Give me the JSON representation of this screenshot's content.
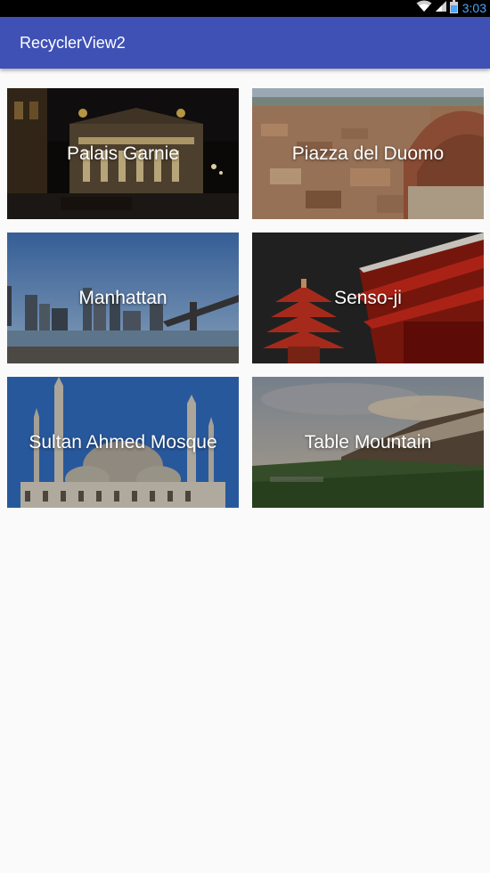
{
  "status_bar": {
    "time": "3:03",
    "icons": [
      "wifi-icon",
      "signal-icon",
      "battery-icon"
    ],
    "time_color": "#4aa6ff"
  },
  "app_bar": {
    "title": "RecyclerView2",
    "color": "#3f51b5"
  },
  "items": [
    {
      "title": "Palais Garnie"
    },
    {
      "title": "Piazza del Duomo"
    },
    {
      "title": "Manhattan"
    },
    {
      "title": "Senso-ji"
    },
    {
      "title": "Sultan Ahmed Mosque"
    },
    {
      "title": "Table Mountain"
    }
  ]
}
